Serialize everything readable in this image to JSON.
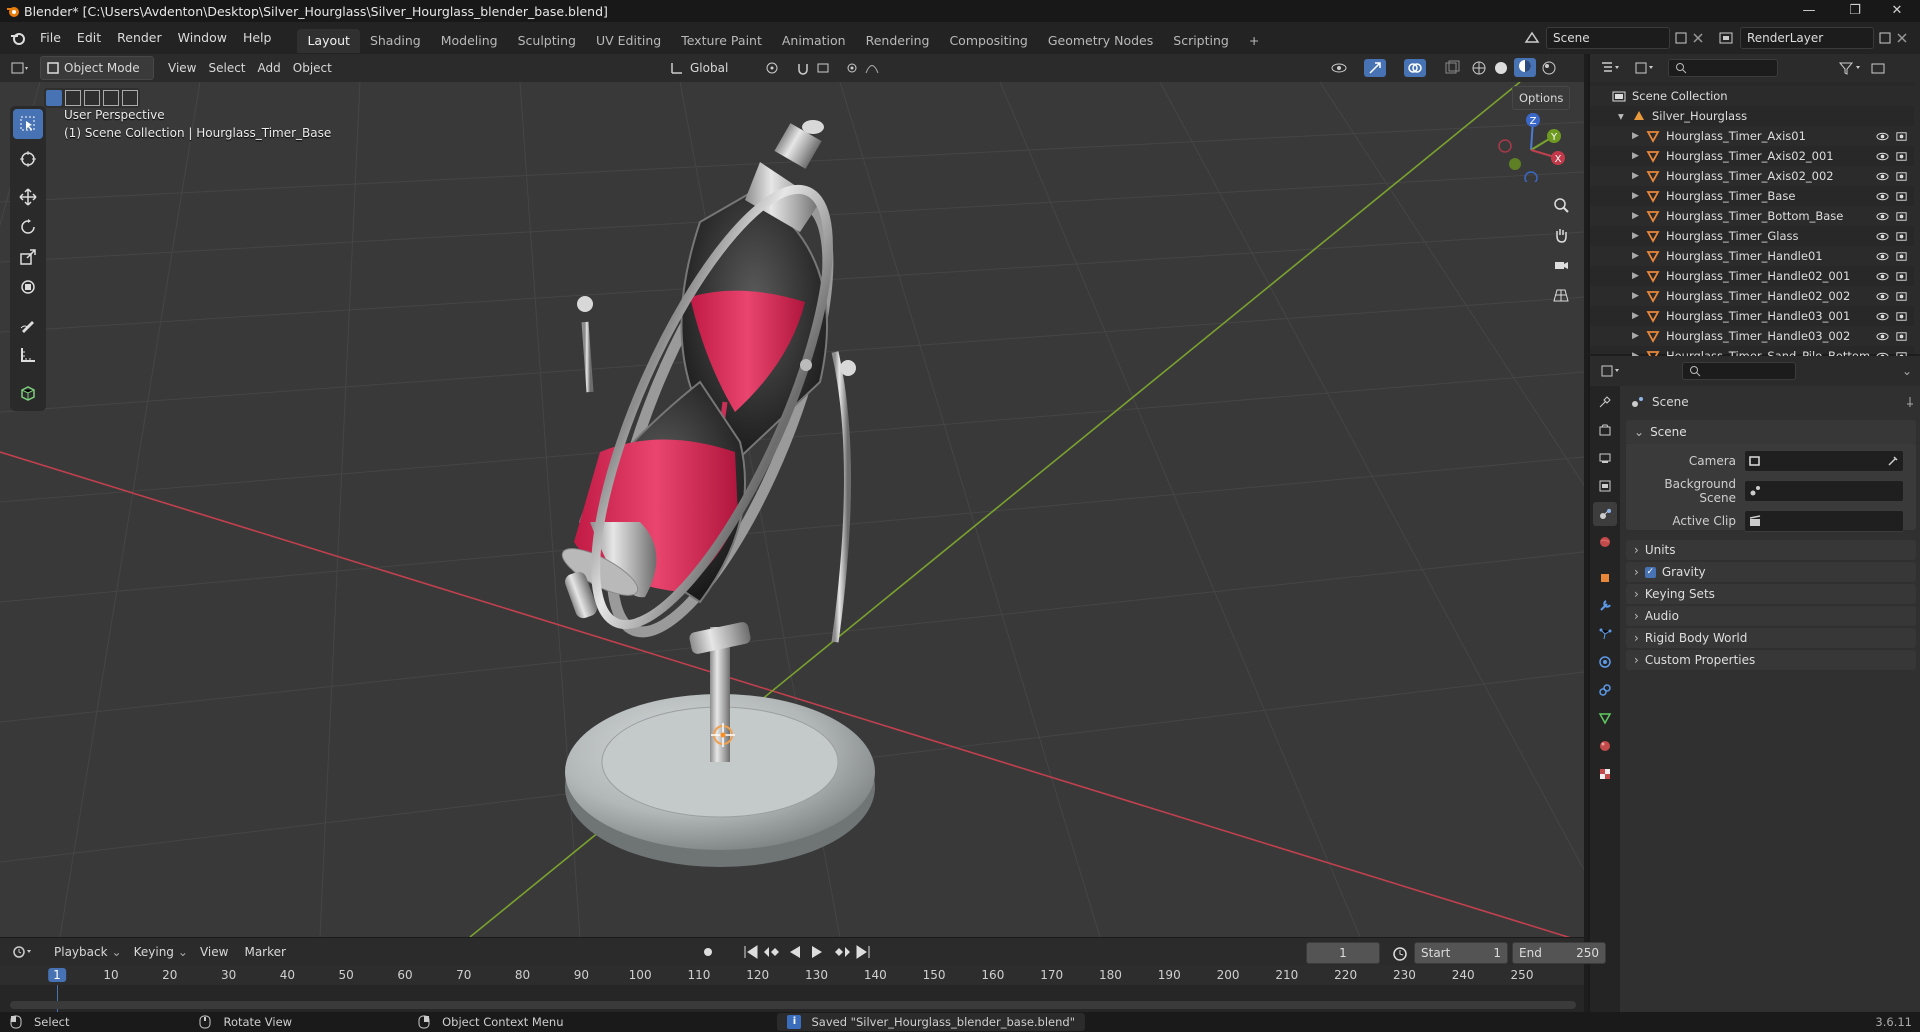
{
  "window": {
    "title": "Blender* [C:\\Users\\Avdenton\\Desktop\\Silver_Hourglass\\Silver_Hourglass_blender_base.blend]",
    "minimize_glyph": "—",
    "maximize_glyph": "❐",
    "close_glyph": "✕"
  },
  "menubar": {
    "items": [
      "File",
      "Edit",
      "Render",
      "Window",
      "Help"
    ]
  },
  "workspaces": {
    "tabs": [
      "Layout",
      "Shading",
      "Modeling",
      "Sculpting",
      "UV Editing",
      "Texture Paint",
      "Animation",
      "Rendering",
      "Compositing",
      "Geometry Nodes",
      "Scripting"
    ],
    "active": "Layout",
    "add_glyph": "+"
  },
  "scene_selector": {
    "value": "Scene"
  },
  "view_layer_selector": {
    "value": "RenderLayer"
  },
  "viewport_header": {
    "mode": "Object Mode",
    "menus": [
      "View",
      "Select",
      "Add",
      "Object"
    ],
    "orientation": "Global",
    "options": "Options"
  },
  "viewport": {
    "perspective_label": "User Perspective",
    "collection_label": "(1) Scene Collection | Hourglass_Timer_Base",
    "gizmo_axes": {
      "z": "Z",
      "y": "Y",
      "x": "X"
    },
    "colors": {
      "background": "#393939",
      "grid": "#474747",
      "x_axis": "#c0404e",
      "y_axis": "#7aa22e",
      "sand": "#e0335f",
      "silver": "#c9c9c9",
      "selection": "#4772b3"
    }
  },
  "outliner": {
    "root": "Scene Collection",
    "collection": "Silver_Hourglass",
    "objects": [
      "Hourglass_Timer_Axis01",
      "Hourglass_Timer_Axis02_001",
      "Hourglass_Timer_Axis02_002",
      "Hourglass_Timer_Base",
      "Hourglass_Timer_Bottom_Base",
      "Hourglass_Timer_Glass",
      "Hourglass_Timer_Handle01",
      "Hourglass_Timer_Handle02_001",
      "Hourglass_Timer_Handle02_002",
      "Hourglass_Timer_Handle03_001",
      "Hourglass_Timer_Handle03_002",
      "Hourglass_Timer_Sand_Pile_Bottom"
    ]
  },
  "properties": {
    "context": "Scene",
    "scene_panel": "Scene",
    "fields": [
      {
        "label": "Camera"
      },
      {
        "label": "Background Scene"
      },
      {
        "label": "Active Clip"
      }
    ],
    "panels": [
      "Units",
      "Gravity",
      "Keying Sets",
      "Audio",
      "Rigid Body World",
      "Custom Properties"
    ]
  },
  "timeline": {
    "menus": [
      "Playback",
      "Keying",
      "View",
      "Marker"
    ],
    "current_frame": "1",
    "start_label": "Start",
    "start": "1",
    "end_label": "End",
    "end": "250",
    "ruler": [
      "1",
      "10",
      "20",
      "30",
      "40",
      "50",
      "60",
      "70",
      "80",
      "90",
      "100",
      "110",
      "120",
      "130",
      "140",
      "150",
      "160",
      "170",
      "180",
      "190",
      "200",
      "210",
      "220",
      "230",
      "240",
      "250"
    ]
  },
  "statusbar": {
    "select": "Select",
    "rotate": "Rotate View",
    "context_menu": "Object Context Menu",
    "message": "Saved \"Silver_Hourglass_blender_base.blend\"",
    "version": "3.6.11"
  }
}
